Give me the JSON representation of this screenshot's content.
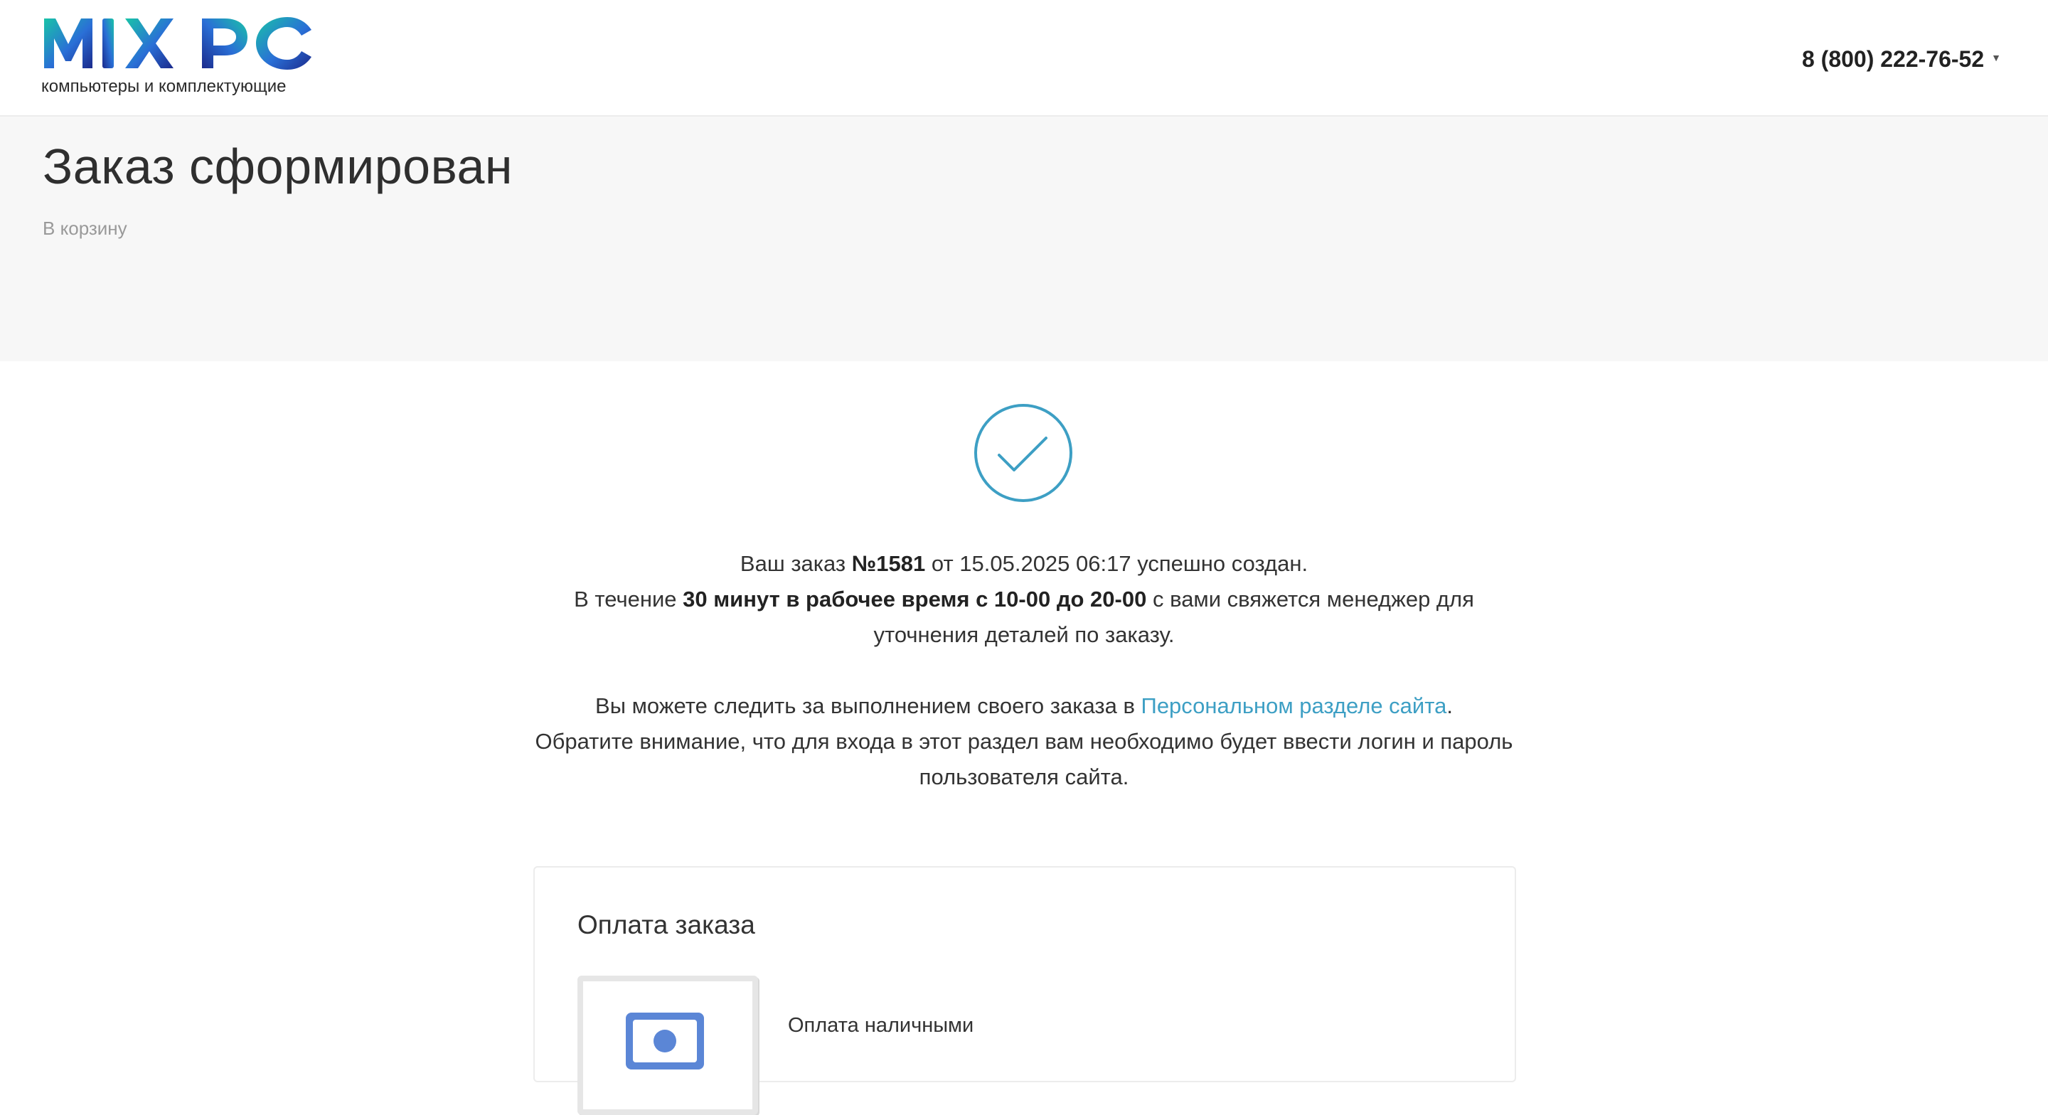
{
  "header": {
    "logo_text": "MIX PC",
    "tagline": "компьютеры и комплектующие",
    "phone": "8 (800) 222-76-52"
  },
  "page": {
    "title": "Заказ сформирован",
    "breadcrumb": "В корзину"
  },
  "message": {
    "order_prefix": "Ваш заказ ",
    "order_number": "№1581",
    "order_suffix": " от 15.05.2025 06:17 успешно создан.",
    "contact_prefix": "В течение ",
    "contact_bold": "30 минут в рабочее время с 10-00 до 20-00",
    "contact_suffix": " с вами свяжется менеджер для уточнения деталей по заказу.",
    "track_prefix": "Вы можете следить за выполнением своего заказа в ",
    "track_link": "Персональном разделе сайта",
    "track_suffix": ".",
    "note": "Обратите внимание, что для входа в этот раздел вам необходимо будет ввести логин и пароль пользователя сайта."
  },
  "payment": {
    "title": "Оплата заказа",
    "method_label": "Оплата наличными",
    "method_icon": "cash-icon"
  },
  "colors": {
    "accent": "#3d9fc4",
    "band": "#f7f7f7",
    "logo_gradient": [
      "#19c3a8",
      "#2a6fd6",
      "#1b2a8c"
    ]
  }
}
